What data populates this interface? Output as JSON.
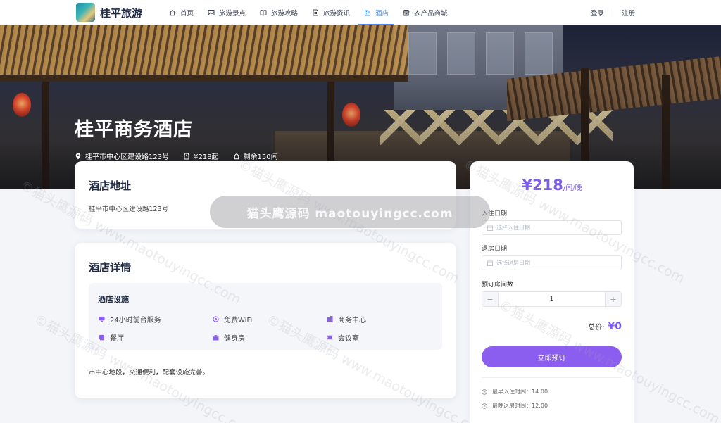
{
  "header": {
    "logo_text": "桂平旅游",
    "nav": [
      {
        "label": "首页",
        "icon": "home-icon"
      },
      {
        "label": "旅游景点",
        "icon": "image-icon"
      },
      {
        "label": "旅游攻略",
        "icon": "book-icon"
      },
      {
        "label": "旅游资讯",
        "icon": "news-icon"
      },
      {
        "label": "酒店",
        "icon": "hotel-icon",
        "active": true
      },
      {
        "label": "农产品商城",
        "icon": "shop-icon"
      }
    ],
    "login": "登录",
    "register": "注册"
  },
  "hero": {
    "title": "桂平商务酒店",
    "address": "桂平市中心区建设路123号",
    "price": "¥218起",
    "rooms_left": "剩余150间"
  },
  "address_card": {
    "heading": "酒店地址",
    "text": "桂平市中心区建设路123号"
  },
  "detail_card": {
    "heading": "酒店详情",
    "facilities_heading": "酒店设施",
    "facilities": [
      {
        "label": "24小时前台服务",
        "icon": "desk-icon"
      },
      {
        "label": "免费WiFi",
        "icon": "wifi-icon"
      },
      {
        "label": "商务中心",
        "icon": "building-icon"
      },
      {
        "label": "餐厅",
        "icon": "restaurant-icon"
      },
      {
        "label": "健身房",
        "icon": "gym-icon"
      },
      {
        "label": "会议室",
        "icon": "meeting-icon"
      }
    ],
    "description": "市中心地段，交通便利，配套设施完善。"
  },
  "booking": {
    "price": "¥218",
    "price_unit": "/间/晚",
    "checkin_label": "入住日期",
    "checkin_placeholder": "选择入住日期",
    "checkout_label": "退房日期",
    "checkout_placeholder": "选择退房日期",
    "rooms_label": "预订房间数",
    "rooms_value": "1",
    "minus": "−",
    "plus": "+",
    "total_label": "总价:",
    "total_value": "¥0",
    "book_button": "立即预订",
    "checkin_time": "最早入住时间：14:00",
    "checkout_time": "最晚退房时间：12:00"
  },
  "watermark": {
    "banner": "猫头鹰源码 maotouyingcc.com",
    "tile": "©猫头鹰源码 www.maotouyingcc.com"
  },
  "colors": {
    "accent": "#7c5cf0",
    "button": "#8c5ef0",
    "nav_active": "#4a8be8"
  }
}
